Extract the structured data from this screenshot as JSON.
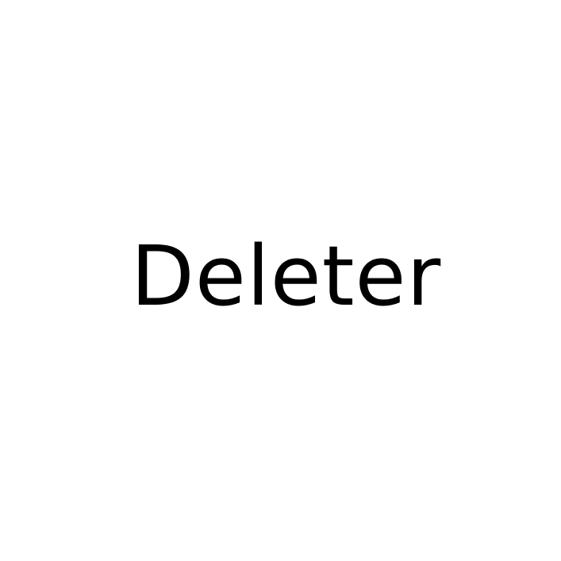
{
  "word": "Deleter",
  "colors": {
    "background": "#ffffff",
    "text": "#000000"
  }
}
